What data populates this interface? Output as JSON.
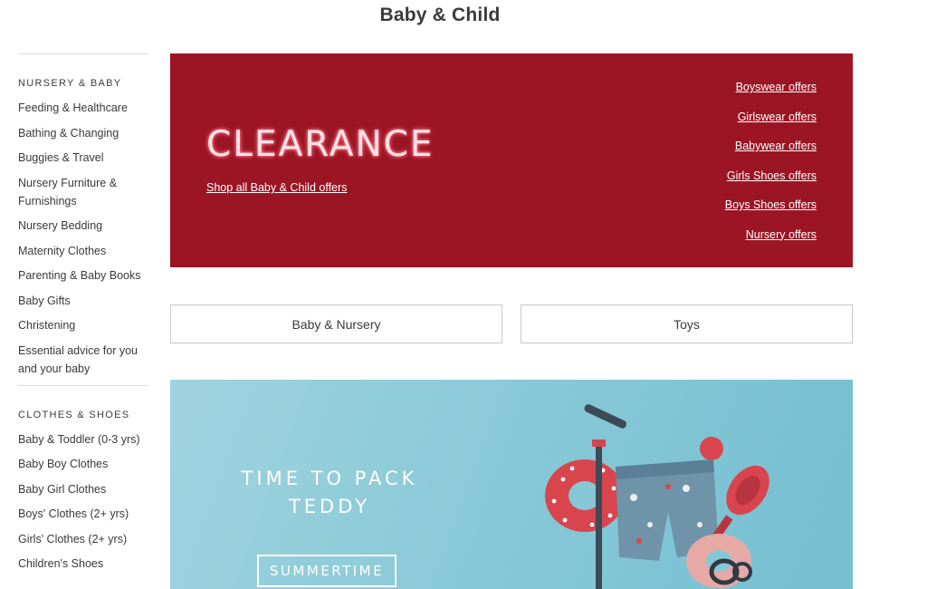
{
  "page": {
    "title": "Baby & Child"
  },
  "sidebar": {
    "sections": [
      {
        "heading": "NURSERY & BABY",
        "items": [
          "Feeding & Healthcare",
          "Bathing & Changing",
          "Buggies & Travel",
          "Nursery Furniture & Furnishings",
          "Nursery Bedding",
          "Maternity Clothes",
          "Parenting & Baby Books",
          "Baby Gifts",
          "Christening",
          "Essential advice for you and your baby"
        ]
      },
      {
        "heading": "CLOTHES & SHOES",
        "items": [
          "Baby & Toddler (0-3 yrs)",
          "Baby Boy Clothes",
          "Baby Girl Clothes",
          "Boys' Clothes (2+ yrs)",
          "Girls' Clothes (2+ yrs)",
          "Children's Shoes"
        ]
      }
    ]
  },
  "clearance": {
    "title": "CLEARANCE",
    "shop_all": "Shop all Baby & Child offers",
    "offers": [
      "Boyswear offers",
      "Girlswear offers",
      "Babywear offers",
      "Girls Shoes offers",
      "Boys Shoes offers",
      "Nursery offers"
    ],
    "bg_color": "#9b1524"
  },
  "categories": {
    "left": "Baby & Nursery",
    "right": "Toys"
  },
  "summer": {
    "title": "TIME TO PACK TEDDY",
    "button": "SUMMERTIME",
    "bg_color": "#86c7d6"
  }
}
